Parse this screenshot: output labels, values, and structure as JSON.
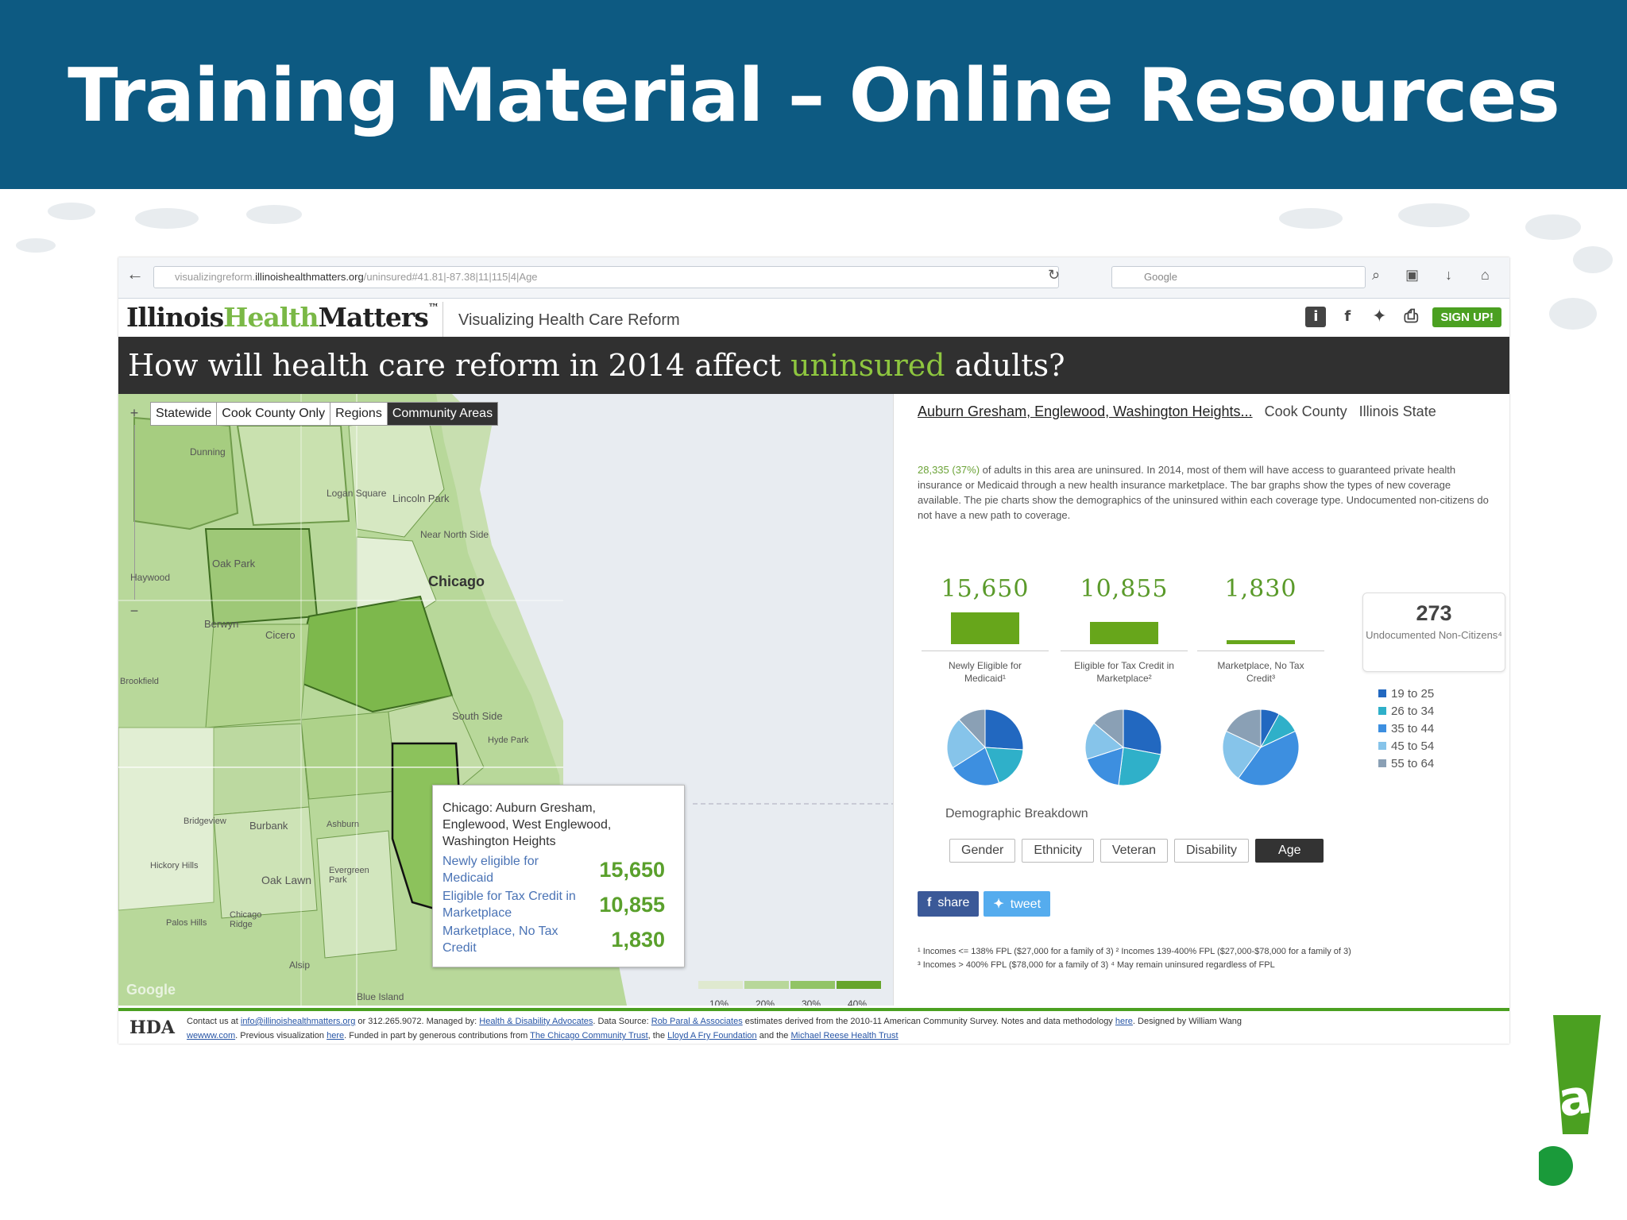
{
  "slide": {
    "title": "Training Material – Online Resources"
  },
  "browser": {
    "url_prefix": "visualizingreform.",
    "url_domain": "illinoishealthmatters.org",
    "url_path": "/uninsured#41.81|-87.38|11|115|4|Age",
    "search_placeholder": "Google"
  },
  "site": {
    "brand_part1": "Illinois",
    "brand_part2": "Health",
    "brand_part3": "Matters",
    "tm": "™",
    "subtitle": "Visualizing Health Care Reform",
    "signup_label": "SIGN UP!"
  },
  "headline": {
    "pre": "How will health care reform in 2014 affect ",
    "highlight": "uninsured",
    "post": " adults?"
  },
  "map": {
    "tabs": [
      "Statewide",
      "Cook County Only",
      "Regions",
      "Community Areas"
    ],
    "active_tab": 3,
    "labels": {
      "chicago": "Chicago",
      "lincoln": "Lincoln Park",
      "logan": "Logan Square",
      "dunning": "Dunning",
      "northside": "Near North Side",
      "oakpark": "Oak Park",
      "berwyn": "Berwyn",
      "cicero": "Cicero",
      "southside": "South Side",
      "hydepark": "Hyde Park",
      "burbank": "Burbank",
      "oaklawn": "Oak Lawn",
      "bridgeview": "Bridgeview",
      "hickory": "Hickory Hills",
      "palos": "Palos Hills",
      "chicagoridge": "Chicago Ridge",
      "blueisland": "Blue Island",
      "alsip": "Alsip",
      "evergreen": "Evergreen Park",
      "brookfield": "Brookfield",
      "haywood": "Haywood",
      "ashburn": "Ashburn",
      "google": "Google"
    },
    "popup": {
      "area": "Chicago: Auburn Gresham, Englewood, West Englewood, Washington Heights",
      "rows": [
        {
          "label": "Newly eligible for Medicaid",
          "value": "15,650"
        },
        {
          "label": "Eligible for Tax Credit in Marketplace",
          "value": "10,855"
        },
        {
          "label": "Marketplace, No Tax Credit",
          "value": "1,830"
        }
      ]
    },
    "legend": {
      "labels": [
        "10%",
        "20%",
        "30%",
        "40%"
      ],
      "colors": [
        "#dfe9cf",
        "#b8d79a",
        "#92c466",
        "#66a52c"
      ]
    }
  },
  "panel": {
    "crumb_area": "Auburn Gresham, Englewood, Washington Heights...",
    "crumb_county": "Cook County",
    "crumb_state": "Illinois State",
    "desc_highlight": "28,335 (37%)",
    "desc": " of adults in this area are uninsured. In 2014, most of them will have access to guaranteed private health insurance or Medicaid through a new health insurance marketplace. The bar graphs show the types of new coverage available. The pie charts show the demographics of the uninsured within each coverage type. Undocumented non-citizens do not have a new path to coverage.",
    "stats": [
      {
        "value": "15,650",
        "label": "Newly Eligible for Medicaid¹"
      },
      {
        "value": "10,855",
        "label": "Eligible for Tax Credit in Marketplace²"
      },
      {
        "value": "1,830",
        "label": "Marketplace, No Tax Credit³"
      }
    ],
    "undoc": {
      "value": "273",
      "label": "Undocumented Non-Citizens⁴"
    },
    "age_legend": [
      {
        "label": "19 to 25",
        "color": "#2268c0"
      },
      {
        "label": "26 to 34",
        "color": "#2fb0c9"
      },
      {
        "label": "35 to 44",
        "color": "#3d8fe0"
      },
      {
        "label": "45 to 54",
        "color": "#86c4ea"
      },
      {
        "label": "55 to 64",
        "color": "#8aa0b5"
      }
    ],
    "demographic_title": "Demographic Breakdown",
    "demo_tabs": [
      "Gender",
      "Ethnicity",
      "Veteran",
      "Disability",
      "Age"
    ],
    "demo_active": 4,
    "share": "share",
    "tweet": "tweet",
    "note1": "¹ Incomes <= 138% FPL ($27,000 for a family of 3)  ² Incomes 139-400% FPL ($27,000-$78,000 for a family of 3)",
    "note2": "³ Incomes > 400% FPL ($78,000 for a family of 3)  ⁴ May remain uninsured regardless of FPL"
  },
  "chart_data": [
    {
      "type": "bar",
      "categories": [
        "Newly Eligible for Medicaid",
        "Eligible for Tax Credit in Marketplace",
        "Marketplace, No Tax Credit"
      ],
      "values": [
        15650,
        10855,
        1830
      ]
    },
    {
      "type": "pie",
      "title": "Newly Eligible for Medicaid",
      "categories": [
        "19 to 25",
        "26 to 34",
        "35 to 44",
        "45 to 54",
        "55 to 64"
      ],
      "values": [
        26,
        18,
        22,
        22,
        12
      ]
    },
    {
      "type": "pie",
      "title": "Eligible for Tax Credit in Marketplace",
      "categories": [
        "19 to 25",
        "26 to 34",
        "35 to 44",
        "45 to 54",
        "55 to 64"
      ],
      "values": [
        28,
        24,
        18,
        16,
        14
      ]
    },
    {
      "type": "pie",
      "title": "Marketplace, No Tax Credit",
      "categories": [
        "19 to 25",
        "26 to 34",
        "35 to 44",
        "45 to 54",
        "55 to 64"
      ],
      "values": [
        8,
        10,
        42,
        22,
        18
      ]
    }
  ],
  "footer": {
    "line1_a": "Contact us at ",
    "email": "info@illinoishealthmatters.org",
    "line1_b": " or 312.265.9072. Managed by: ",
    "hda": "Health & Disability Advocates",
    "line1_c": ". Data Source: ",
    "rpa": "Rob Paral & Associates",
    "line1_d": " estimates derived from the 2010-11 American Community Survey. Notes and data methodology ",
    "here": "here",
    "line1_e": ". Designed by William Wang",
    "line2_a": "wewww.com",
    "line2_b": ". Previous visualization ",
    "line2_c": ". Funded in part by generous contributions from ",
    "cct": "The Chicago Community Trust",
    "line2_d": ", the ",
    "laf": "Lloyd A Fry Foundation",
    "line2_e": " and the ",
    "mrh": "Michael Reese Health Trust",
    "logo": "HDA"
  },
  "corner_logo": "a"
}
